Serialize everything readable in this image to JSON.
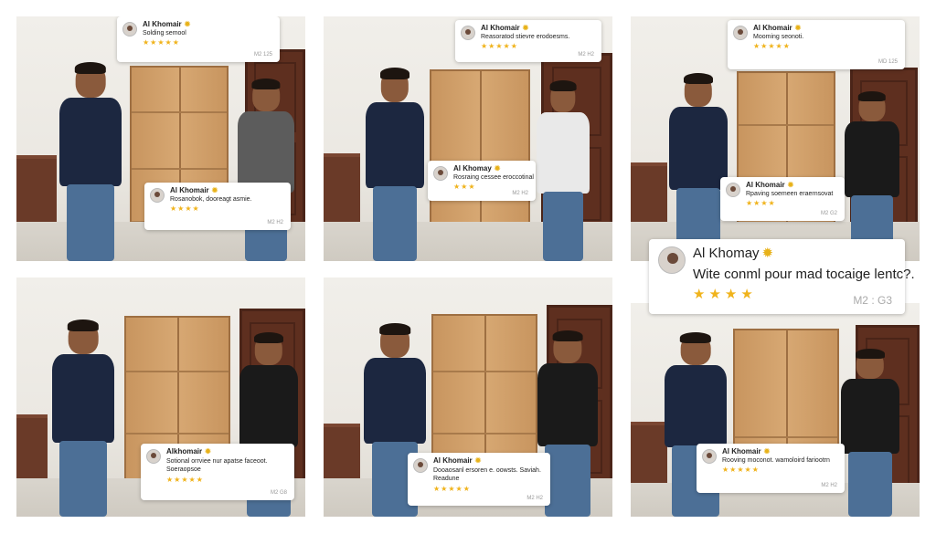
{
  "colors": {
    "navy_shirt": "#1c2740",
    "grey_shirt": "#5c5c5c",
    "white_shirt": "#e9e9e9",
    "black_shirt": "#1a1a1a",
    "star": "#f0b31b",
    "verified": "#e8b21a"
  },
  "icons": {
    "avatar": "avatar",
    "verified": "verified-badge-icon",
    "star": "star-icon"
  },
  "reviews": [
    {
      "name": "Al Khomair",
      "text": "Solding semool",
      "stars": "★★★★★",
      "code": "M2 125"
    },
    {
      "name": "Al Khomair",
      "text": "Rosanobok, dooreagt asmie.",
      "stars": "★★★★",
      "code": "M2 H2"
    },
    {
      "name": "Al Khomair",
      "text": "Reasoratod stievre erodoesms.",
      "stars": "★★★★★",
      "code": "M2 H2"
    },
    {
      "name": "Al Khomay",
      "text": "Rosraing cessee eroccotinal",
      "stars": "★★★",
      "code": "M2 H2"
    },
    {
      "name": "Al Khomair",
      "text": "Mooming seonoti.",
      "stars": "★★★★★",
      "code": "MD 125"
    },
    {
      "name": "Al Khomair",
      "text": "Rpaving soemeen eraernsovat",
      "stars": "★★★★",
      "code": "M2 G2"
    },
    {
      "name": "Al Khomay",
      "text": "Wite conml pour mad tocaige lentc?.",
      "stars": "★★★★",
      "code": "M2 : G3"
    },
    {
      "name": "Alkhomair",
      "text": "Sotional orrviee nur apatse faceoot. Soeraopsoe",
      "stars": "★★★★★",
      "code": "M2 G8"
    },
    {
      "name": "Al Khomair",
      "text": "Dooaosanl ersoren e. oowsts. Saviah. Readune",
      "stars": "★★★★★",
      "code": "M2 H2"
    },
    {
      "name": "Al Khomair",
      "text": "Rooving moconot. wamoloird fariootrn",
      "stars": "★★★★★",
      "code": "M2 H2"
    }
  ]
}
